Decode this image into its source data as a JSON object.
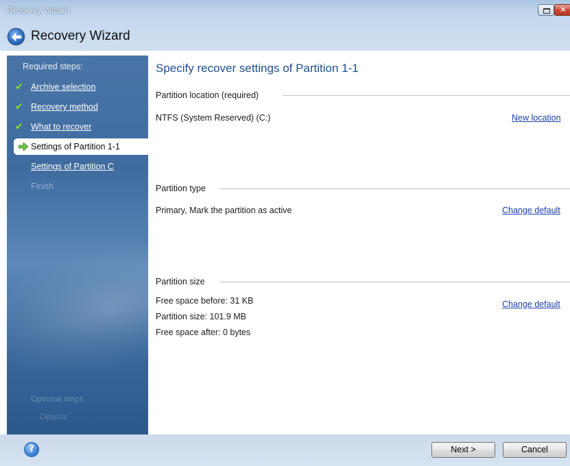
{
  "window": {
    "title": "Recovery Wizard"
  },
  "header": {
    "title": "Recovery Wizard",
    "back_icon": "back-arrow-icon"
  },
  "sidebar": {
    "required_label": "Required steps:",
    "steps": [
      {
        "label": "Archive selection",
        "state": "completed"
      },
      {
        "label": "Recovery method",
        "state": "completed"
      },
      {
        "label": "What to recover",
        "state": "completed"
      },
      {
        "label": "Settings of Partition 1-1",
        "state": "current"
      },
      {
        "label": "Settings of Partition C",
        "state": "pending"
      },
      {
        "label": "Finish",
        "state": "disabled"
      }
    ],
    "optional_label": "Optional steps",
    "optional_items": [
      "Options"
    ]
  },
  "main": {
    "title": "Specify recover settings of Partition 1-1",
    "sections": {
      "location": {
        "heading": "Partition location (required)",
        "value": "NTFS (System Reserved) (C:)",
        "link": "New location"
      },
      "type": {
        "heading": "Partition type",
        "value": "Primary, Mark the partition as active",
        "link": "Change default"
      },
      "size": {
        "heading": "Partition size",
        "lines": [
          "Free space before: 31 KB",
          "Partition size: 101.9 MB",
          "Free space after: 0 bytes"
        ],
        "link": "Change default"
      }
    }
  },
  "footer": {
    "help_label": "?",
    "next_label": "Next >",
    "cancel_label": "Cancel"
  }
}
